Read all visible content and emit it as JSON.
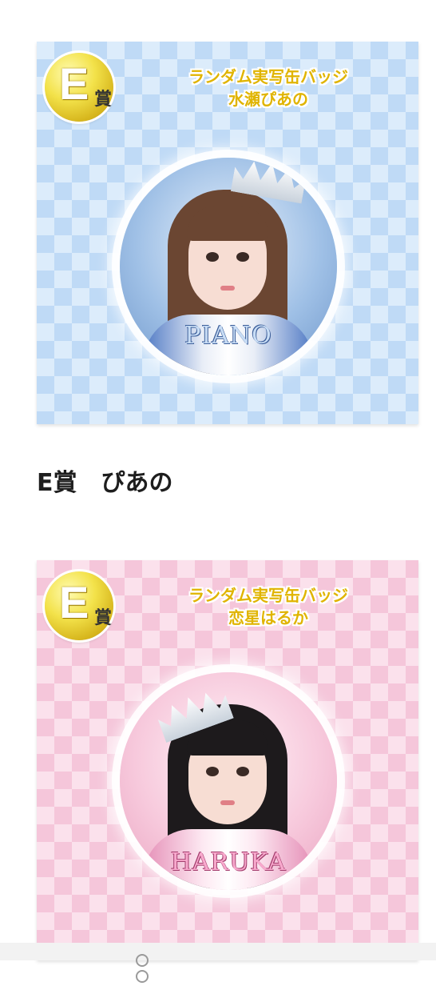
{
  "cards": [
    {
      "prize_letter": "E",
      "prize_kanji": "賞",
      "title_line1": "ランダム実写缶バッジ",
      "title_line2": "水瀬ぴあの",
      "badge_name": "PIANO",
      "theme_color": "#bfdaf6"
    },
    {
      "prize_letter": "E",
      "prize_kanji": "賞",
      "title_line1": "ランダム実写缶バッジ",
      "title_line2": "恋星はるか",
      "badge_name": "HARUKA",
      "theme_color": "#f5c6da"
    }
  ],
  "caption": {
    "text": "E賞　ぴあの"
  }
}
